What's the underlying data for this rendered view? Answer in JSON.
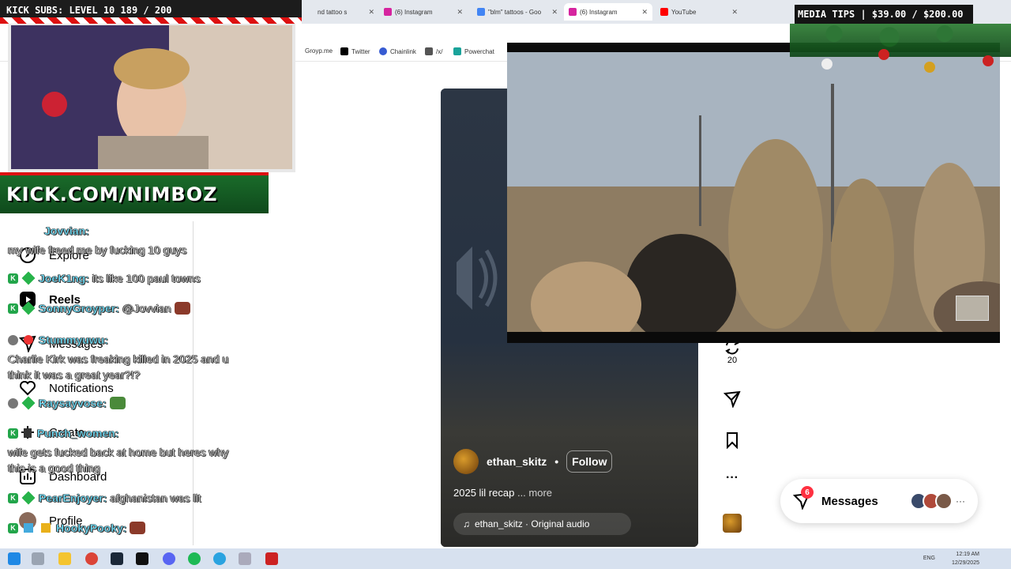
{
  "browser": {
    "tabs": [
      {
        "label": "nd tattoo s",
        "active": false
      },
      {
        "label": "(6) Instagram",
        "active": false
      },
      {
        "label": "\"blm\" tattoos - Goo",
        "active": false
      },
      {
        "label": "(6) Instagram",
        "active": true
      },
      {
        "label": "YouTube",
        "active": false
      }
    ],
    "bookmarks": [
      "Groyp.me",
      "Twitter",
      "Chainlink",
      "/x/",
      "Powerchat"
    ]
  },
  "instagram": {
    "nav": [
      {
        "label": "Explore",
        "icon": "compass-icon"
      },
      {
        "label": "Reels",
        "icon": "reels-icon"
      },
      {
        "label": "Messages",
        "icon": "messenger-icon"
      },
      {
        "label": "Notifications",
        "icon": "heart-icon"
      },
      {
        "label": "Create",
        "icon": "plus-icon"
      },
      {
        "label": "Dashboard",
        "icon": "dashboard-icon"
      },
      {
        "label": "Profile",
        "icon": "avatar"
      }
    ],
    "reel": {
      "username": "ethan_skitz",
      "separator": "•",
      "follow_label": "Follow",
      "caption": "2025 lil recap",
      "more_label": "... more",
      "audio": "ethan_skitz · Original audio"
    },
    "actions": {
      "repost_count": "20"
    },
    "messages": {
      "label": "Messages",
      "badge": "6"
    }
  },
  "overlay": {
    "subs": "KICK SUBS: LEVEL 10 189 / 200",
    "tips": "MEDIA TIPS | $39.00 / $200.00",
    "kick_url": "KICK.COM/NIMBOZ"
  },
  "chat": [
    {
      "user": "Jovvian:",
      "msg": "",
      "badges": false
    },
    {
      "user": "",
      "msg": "my wife freed me by fucking 10 guys",
      "badges": false
    },
    {
      "user": "JoeK1ng:",
      "msg": "its like 100 paul towns",
      "badges": true
    },
    {
      "user": "SonnyGroyper:",
      "msg": "@Jovvian",
      "badges": true
    },
    {
      "user": "Stummyuwu:",
      "msg": "",
      "badges": true
    },
    {
      "user": "",
      "msg": "Charlie Kirk was freaking killed in 2025 and u",
      "badges": false
    },
    {
      "user": "",
      "msg": "think it was a great year?!?",
      "badges": false
    },
    {
      "user": "Raysayvose:",
      "msg": "",
      "badges": true
    },
    {
      "user": "Punch_women:",
      "msg": "",
      "badges": true
    },
    {
      "user": "",
      "msg": "wife gets fucked back at home but heres why",
      "badges": false
    },
    {
      "user": "",
      "msg": "this is a good thing",
      "badges": false
    },
    {
      "user": "PearEnjoyer:",
      "msg": "afghanistan was lit",
      "badges": true
    },
    {
      "user": "HookyPooky:",
      "msg": "",
      "badges": true
    }
  ],
  "taskbar": {
    "lang": "ENG",
    "time": "12:19 AM",
    "date": "12/29/2025"
  },
  "colors": {
    "ig_red": "#ff3040",
    "kick_green": "#22a54a",
    "chat_user": "#6fe3ff"
  }
}
